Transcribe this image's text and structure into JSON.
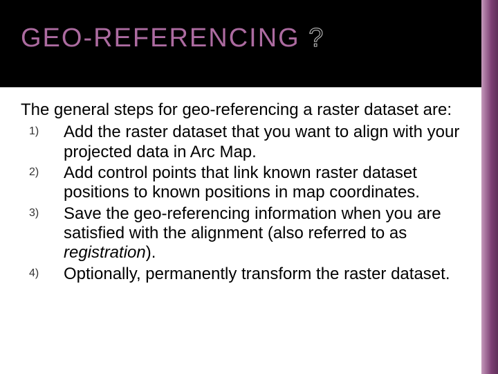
{
  "header": {
    "title_fill": "GEO-REFERENCING",
    "title_outline": " ?"
  },
  "body": {
    "intro": "The general steps for geo-referencing a raster dataset are:",
    "steps": [
      "Add the raster dataset that you want to align with your projected data in Arc Map.",
      "Add control points that link known raster dataset positions to known positions in map coordinates.",
      "Save the geo-referencing information when you are satisfied with the alignment (also referred to as ",
      "Optionally, permanently transform the raster dataset."
    ],
    "step3_italic": "registration",
    "step3_tail": ")."
  }
}
